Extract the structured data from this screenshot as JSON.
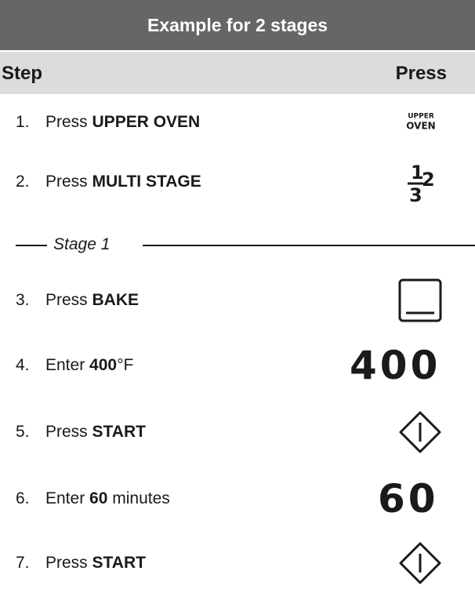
{
  "title": "Example for 2 stages",
  "header": {
    "step": "Step",
    "press": "Press"
  },
  "stage_label": "Stage 1",
  "steps": [
    {
      "num": "1.",
      "pre": "Press ",
      "bold": "UPPER OVEN",
      "post": "",
      "key": {
        "type": "text",
        "line1": "UPPER",
        "line2": "OVEN"
      }
    },
    {
      "num": "2.",
      "pre": "Press ",
      "bold": "MULTI STAGE",
      "post": "",
      "key": {
        "type": "icon",
        "icon": "multi-stage-icon",
        "digits": [
          "1",
          "2",
          "3"
        ]
      }
    },
    {
      "num": "3.",
      "pre": "Press ",
      "bold": "BAKE",
      "post": "",
      "key": {
        "type": "icon",
        "icon": "bake-icon"
      }
    },
    {
      "num": "4.",
      "pre": "Enter ",
      "bold": "400",
      "post": "°F",
      "key": {
        "type": "digits",
        "text": "400"
      }
    },
    {
      "num": "5.",
      "pre": "Press ",
      "bold": "START",
      "post": "",
      "key": {
        "type": "icon",
        "icon": "start-icon"
      }
    },
    {
      "num": "6.",
      "pre": "Enter ",
      "bold": "60",
      "post": " minutes",
      "key": {
        "type": "digits",
        "text": "60"
      }
    },
    {
      "num": "7.",
      "pre": "Press ",
      "bold": "START",
      "post": "",
      "key": {
        "type": "icon",
        "icon": "start-icon"
      }
    }
  ],
  "colors": {
    "title_bg": "#666666",
    "header_bg": "#dcdcdc",
    "text": "#1a1a1a"
  }
}
